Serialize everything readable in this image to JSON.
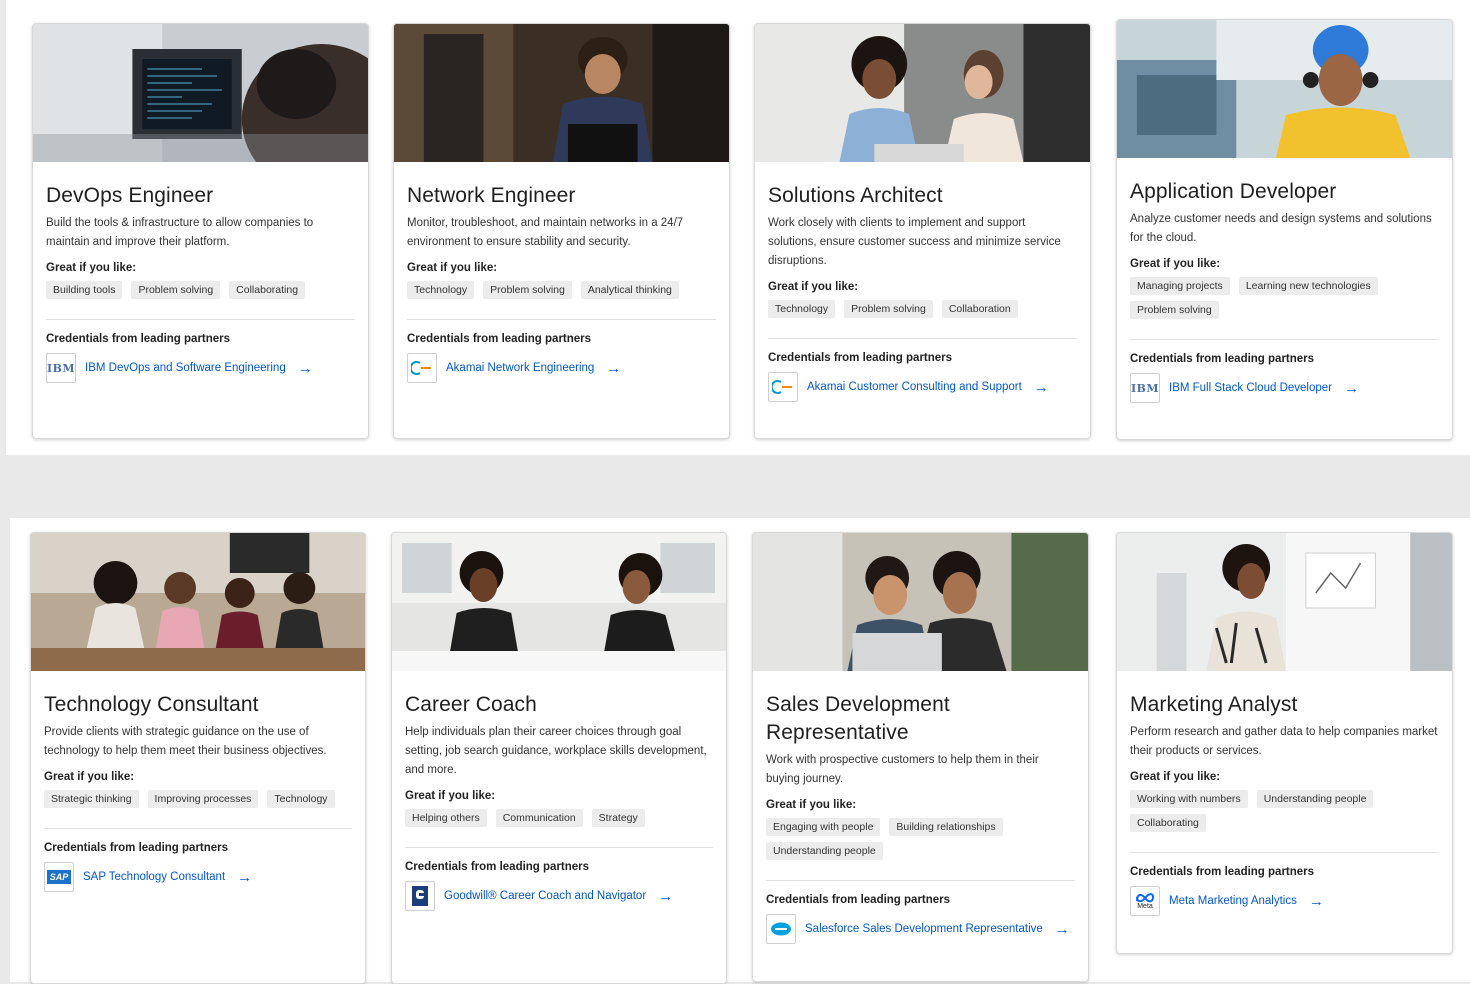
{
  "cards": [
    {
      "title": "DevOps Engineer",
      "description": "Build the tools & infrastructure to allow companies to maintain and improve their platform.",
      "like_label": "Great if you like:",
      "tags": [
        "Building tools",
        "Problem solving",
        "Collaborating"
      ],
      "cred_label": "Credentials from leading partners",
      "credential": "IBM DevOps and Software Engineering",
      "logo": "ibm-logo"
    },
    {
      "title": "Network Engineer",
      "description": "Monitor, troubleshoot, and maintain networks in a 24/7 environment to ensure stability and security.",
      "like_label": "Great if you like:",
      "tags": [
        "Technology",
        "Problem solving",
        "Analytical thinking"
      ],
      "cred_label": "Credentials from leading partners",
      "credential": "Akamai Network Engineering",
      "logo": "akamai-logo"
    },
    {
      "title": "Solutions Architect",
      "description": "Work closely with clients to implement and support solutions, ensure customer success and minimize service disruptions.",
      "like_label": "Great if you like:",
      "tags": [
        "Technology",
        "Problem solving",
        "Collaboration"
      ],
      "cred_label": "Credentials from leading partners",
      "credential": "Akamai Customer Consulting and Support",
      "logo": "akamai-logo"
    },
    {
      "title": "Application Developer",
      "description": "Analyze customer needs and design systems and solutions for the cloud.",
      "like_label": "Great if you like:",
      "tags": [
        "Managing projects",
        "Learning new technologies",
        "Problem solving"
      ],
      "cred_label": "Credentials from leading partners",
      "credential": "IBM Full Stack Cloud Developer",
      "logo": "ibm-logo"
    },
    {
      "title": "Technology Consultant",
      "description": "Provide clients with strategic guidance on the use of technology to help them meet their business objectives.",
      "like_label": "Great if you like:",
      "tags": [
        "Strategic thinking",
        "Improving processes",
        "Technology"
      ],
      "cred_label": "Credentials from leading partners",
      "credential": "SAP Technology Consultant",
      "logo": "sap-logo"
    },
    {
      "title": "Career Coach",
      "description": "Help individuals plan their career choices through goal setting, job search guidance, workplace skills development, and more.",
      "like_label": "Great if you like:",
      "tags": [
        "Helping others",
        "Communication",
        "Strategy"
      ],
      "cred_label": "Credentials from leading partners",
      "credential": "Goodwill® Career Coach and Navigator",
      "logo": "goodwill-logo"
    },
    {
      "title": "Sales Development Representative",
      "description": "Work with prospective customers to help them in their buying journey.",
      "like_label": "Great if you like:",
      "tags": [
        "Engaging with people",
        "Building relationships",
        "Understanding people"
      ],
      "cred_label": "Credentials from leading partners",
      "credential": "Salesforce Sales Development Representative",
      "logo": "salesforce-logo"
    },
    {
      "title": "Marketing Analyst",
      "description": "Perform research and gather data to help companies market their products or services.",
      "like_label": "Great if you like:",
      "tags": [
        "Working with numbers",
        "Understanding people",
        "Collaborating"
      ],
      "cred_label": "Credentials from leading partners",
      "credential": "Meta Marketing Analytics",
      "logo": "meta-logo"
    }
  ],
  "logo_text": {
    "ibm": "IBM",
    "sap": "SAP",
    "meta": "Meta"
  },
  "colors": {
    "link": "#0056d2",
    "tag_bg": "#ececec"
  }
}
